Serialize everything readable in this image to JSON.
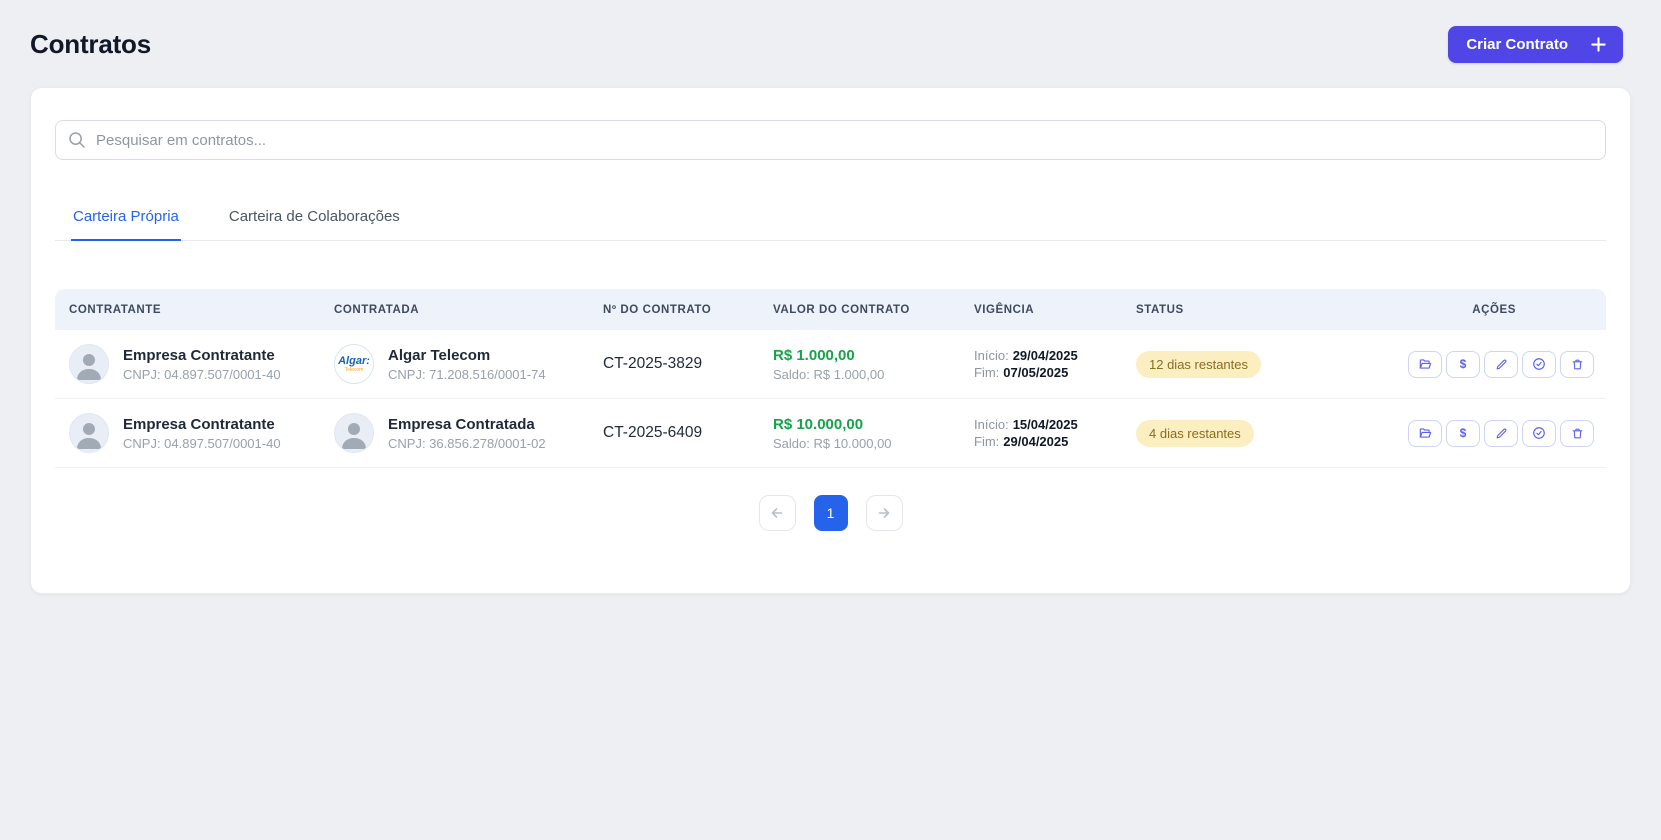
{
  "page": {
    "title": "Contratos"
  },
  "create_button": {
    "label": "Criar Contrato"
  },
  "search": {
    "placeholder": "Pesquisar em contratos..."
  },
  "tabs": {
    "own": {
      "label": "Carteira Própria",
      "active": true
    },
    "collab": {
      "label": "Carteira de Colaborações",
      "active": false
    }
  },
  "table": {
    "columns": [
      "CONTRATANTE",
      "CONTRATADA",
      "Nº DO CONTRATO",
      "VALOR DO CONTRATO",
      "VIGÊNCIA",
      "STATUS",
      "AÇÕES"
    ],
    "rows": [
      {
        "contratante": {
          "name": "Empresa Contratante",
          "cnpj": "CNPJ: 04.897.507/0001-40"
        },
        "contratada": {
          "name": "Algar Telecom",
          "cnpj": "CNPJ: 71.208.516/0001-74",
          "logo_primary": "Algar:",
          "logo_secondary": "Telecom"
        },
        "numero": "CT-2025-3829",
        "valor": "R$ 1.000,00",
        "saldo": "Saldo: R$ 1.000,00",
        "vigencia": {
          "inicio_label": "Início:",
          "inicio": "29/04/2025",
          "fim_label": "Fim:",
          "fim": "07/05/2025"
        },
        "status": "12 dias restantes"
      },
      {
        "contratante": {
          "name": "Empresa Contratante",
          "cnpj": "CNPJ: 04.897.507/0001-40"
        },
        "contratada": {
          "name": "Empresa Contratada",
          "cnpj": "CNPJ: 36.856.278/0001-02"
        },
        "numero": "CT-2025-6409",
        "valor": "R$ 10.000,00",
        "saldo": "Saldo: R$ 10.000,00",
        "vigencia": {
          "inicio_label": "Início:",
          "inicio": "15/04/2025",
          "fim_label": "Fim:",
          "fim": "29/04/2025"
        },
        "status": "4 dias restantes"
      }
    ],
    "action_icons": [
      "folder-open",
      "dollar",
      "pencil",
      "check-circle",
      "trash"
    ]
  },
  "icons": {
    "dollar": "$"
  },
  "pagination": {
    "current_page": "1"
  },
  "colors": {
    "accent": "#4f46e5",
    "tab_active": "#2563eb",
    "money_green": "#16a34a",
    "badge_bg": "#fbeec1",
    "badge_text": "#8a6d1f",
    "header_row_bg": "#eef2fb",
    "pagination_active": "#2563eb"
  }
}
